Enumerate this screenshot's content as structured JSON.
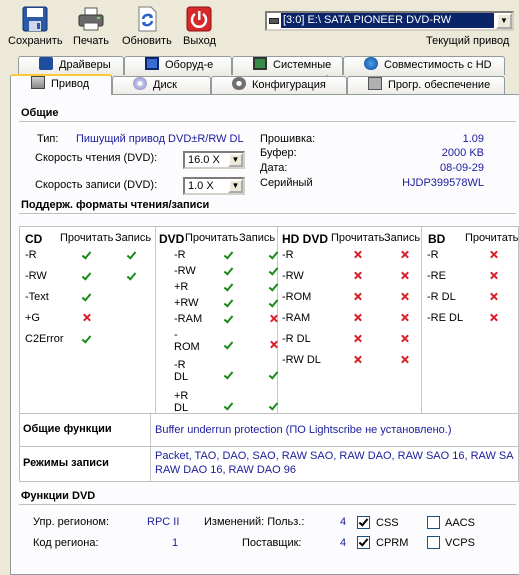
{
  "toolbar": {
    "save": "Сохранить",
    "print": "Печать",
    "refresh": "Обновить",
    "exit": "Выход"
  },
  "drive": {
    "selected": "[3:0]  E:\\ SATA     PIONEER DVD-RW",
    "caption": "Текущий привод"
  },
  "tabs": {
    "drivers": "Драйверы",
    "equipment": "Оборуд-е",
    "system": "Системные",
    "hd_compat": "Совместимость с HD",
    "drive": "Привод",
    "disc": "Диск",
    "config": "Конфигурация",
    "software": "Прогр. обеспечение"
  },
  "general": {
    "heading": "Общие",
    "type_label": "Тип:",
    "type_value": "Пишущий привод DVD±R/RW DL",
    "read_speed_label": "Скорость чтения (DVD):",
    "read_speed_value": "16.0 X",
    "write_speed_label": "Скорость записи (DVD):",
    "write_speed_value": "1.0 X",
    "firmware_label": "Прошивка:",
    "firmware_value": "1.09",
    "buffer_label": "Буфер:",
    "buffer_value": "2000 KB",
    "date_label": "Дата:",
    "date_value": "08-09-29",
    "serial_label": "Серийный",
    "serial_value": "HJDP399578WL"
  },
  "formats": {
    "heading": "Поддерж. форматы чтения/записи",
    "read_col": "Прочитать",
    "write_col": "Запись",
    "cd": {
      "title": "CD",
      "items": [
        "-R",
        "-RW",
        "-Text",
        "+G",
        "C2Error"
      ],
      "read": [
        "yes",
        "yes",
        "yes",
        "no",
        "yes"
      ],
      "write": [
        "yes",
        "yes",
        "",
        "",
        ""
      ]
    },
    "dvd": {
      "title": "DVD",
      "items": [
        "-R",
        "-RW",
        "+R",
        "+RW",
        "-RAM",
        "-\nROM",
        "-R\nDL",
        "+R\nDL"
      ],
      "read": [
        "yes",
        "yes",
        "yes",
        "yes",
        "yes",
        "yes",
        "yes",
        "yes"
      ],
      "write": [
        "yes",
        "yes",
        "yes",
        "yes",
        "no",
        "no",
        "yes",
        "yes"
      ]
    },
    "hddvd": {
      "title": "HD DVD",
      "items": [
        "-R",
        "-RW",
        "-ROM",
        "-RAM",
        "-R DL",
        "-RW DL"
      ],
      "read": [
        "no",
        "no",
        "no",
        "no",
        "no",
        "no"
      ],
      "write": [
        "no",
        "no",
        "no",
        "no",
        "no",
        "no"
      ]
    },
    "bd": {
      "title": "BD",
      "items": [
        "-R",
        "-RE",
        "-R DL",
        "-RE DL"
      ],
      "read": [
        "no",
        "no",
        "no",
        "no"
      ]
    },
    "colors": {
      "yes": "#1a8a1a",
      "no": "#d8202a"
    }
  },
  "functions": {
    "general_label": "Общие функции",
    "general_value": "Buffer underrun protection (ПО Lightscribe не установлено.)",
    "modes_label": "Режимы записи",
    "modes_line1": "Packet, TAO, DAO, SAO, RAW SAO, RAW DAO, RAW SAO 16, RAW SA",
    "modes_line2": "RAW DAO 16, RAW DAO 96"
  },
  "dvd_functions": {
    "heading": "Функции DVD",
    "region_ctrl_label": "Упр. регионом:",
    "region_ctrl_value": "RPC II",
    "region_code_label": "Код региона:",
    "region_code_value": "1",
    "changes_user_label": "Изменений: Польз.:",
    "changes_user_value": "4",
    "vendor_label": "Поставщик:",
    "vendor_value": "4",
    "css": {
      "label": "CSS",
      "checked": true
    },
    "aacs": {
      "label": "AACS",
      "checked": false
    },
    "cprm": {
      "label": "CPRM",
      "checked": true
    },
    "vcps": {
      "label": "VCPS",
      "checked": false
    }
  }
}
